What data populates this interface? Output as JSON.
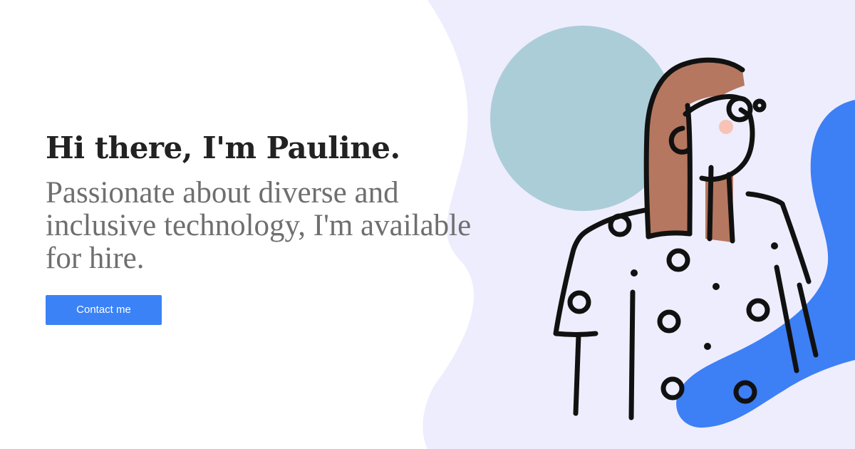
{
  "hero": {
    "title": "Hi there, I'm Pauline.",
    "subtitle": "Passionate about diverse and inclusive technology, I'm available for hire.",
    "contact_label": "Contact me"
  },
  "illustration": {
    "icon": "woman-illustration-icon"
  },
  "colors": {
    "accent": "#3b82f6",
    "background_blob": "#eeedfd",
    "circle": "#abcdd8",
    "hair": "#b5775f",
    "title": "#222222",
    "subtitle": "#6f6f6f"
  }
}
